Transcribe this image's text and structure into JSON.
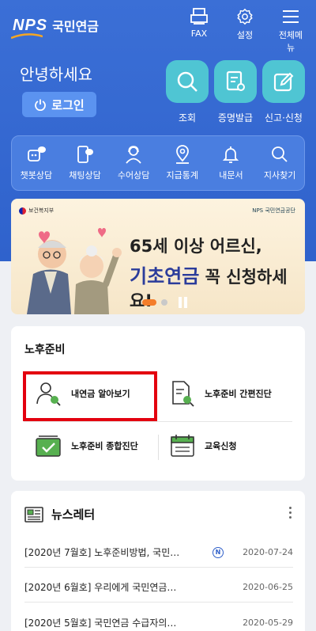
{
  "header": {
    "logo_text": "NPS",
    "logo_name": "국민연금",
    "top_icons": [
      {
        "label": "FAX",
        "icon": "fax-icon"
      },
      {
        "label": "설정",
        "icon": "gear-icon"
      },
      {
        "label": "전체메뉴",
        "icon": "hamburger-icon"
      }
    ],
    "greeting": "안녕하세요",
    "login_label": "로그인"
  },
  "quick_actions": [
    {
      "label": "조회",
      "icon": "search-icon"
    },
    {
      "label": "증명발급",
      "icon": "certificate-icon"
    },
    {
      "label": "신고·신청",
      "icon": "edit-icon"
    }
  ],
  "menu": [
    {
      "label": "챗봇상담",
      "icon": "chatbot-icon"
    },
    {
      "label": "채팅상담",
      "icon": "chat-icon"
    },
    {
      "label": "수어상담",
      "icon": "sign-language-icon"
    },
    {
      "label": "지급통계",
      "icon": "location-icon"
    },
    {
      "label": "내문서",
      "icon": "bell-icon"
    },
    {
      "label": "지사찾기",
      "icon": "search-icon"
    }
  ],
  "banner": {
    "ministry": "보건복지부",
    "org": "NPS 국민연금공단",
    "line1": "65세 이상 어르신,",
    "highlight": "기초연금",
    "line2_rest": " 꼭 신청하세요!"
  },
  "retirement": {
    "title": "노후준비",
    "items": [
      {
        "label": "내연금 알아보기",
        "icon": "person-search-icon"
      },
      {
        "label": "노후준비 간편진단",
        "icon": "document-search-icon"
      },
      {
        "label": "노후준비 종합진단",
        "icon": "checklist-icon"
      },
      {
        "label": "교육신청",
        "icon": "calendar-icon"
      }
    ]
  },
  "newsletter": {
    "title": "뉴스레터",
    "items": [
      {
        "title": "[2020년 7월호] 노후준비방법, 국민…",
        "badge": "N",
        "date": "2020-07-24"
      },
      {
        "title": "[2020년 6월호] 우리에게 국민연금…",
        "badge": "",
        "date": "2020-06-25"
      },
      {
        "title": "[2020년 5월호] 국민연금 수급자의…",
        "badge": "",
        "date": "2020-05-29"
      }
    ]
  },
  "colors": {
    "primary": "#3b6fd6",
    "quick_bg": "#4fc5d3",
    "accent_orange": "#f47d2a",
    "highlight_red": "#e3000f"
  }
}
